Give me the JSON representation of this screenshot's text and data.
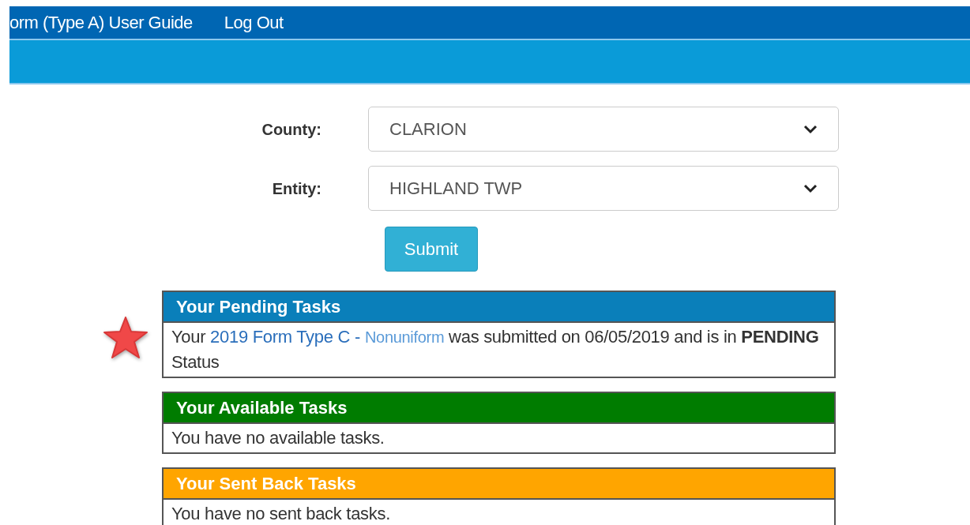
{
  "nav": {
    "items": [
      {
        "label": "orm (Type A) User Guide"
      },
      {
        "label": "Log Out"
      }
    ]
  },
  "form": {
    "fields": [
      {
        "label": "County:",
        "value": "CLARION"
      },
      {
        "label": "Entity:",
        "value": "HIGHLAND TWP"
      }
    ],
    "submit": "Submit"
  },
  "sections": [
    {
      "title": "Your Pending Tasks",
      "color": "#0a7fba",
      "starred": true,
      "parts": [
        {
          "kind": "text",
          "text": "Your "
        },
        {
          "kind": "link",
          "text": "2019 Form Type C -"
        },
        {
          "kind": "link_light",
          "text": "Nonuniform"
        },
        {
          "kind": "text",
          "text": " was submitted on 06/05/2019 and is in **PENDING** Status"
        }
      ]
    },
    {
      "title": "Your Available Tasks",
      "color": "#007c00",
      "starred": false,
      "parts": [
        {
          "kind": "text",
          "text": "You have no available tasks."
        }
      ]
    },
    {
      "title": "Your Sent Back Tasks",
      "color": "#ffa500",
      "starred": false,
      "parts": [
        {
          "kind": "text",
          "text": "You have no sent back tasks."
        }
      ]
    }
  ]
}
